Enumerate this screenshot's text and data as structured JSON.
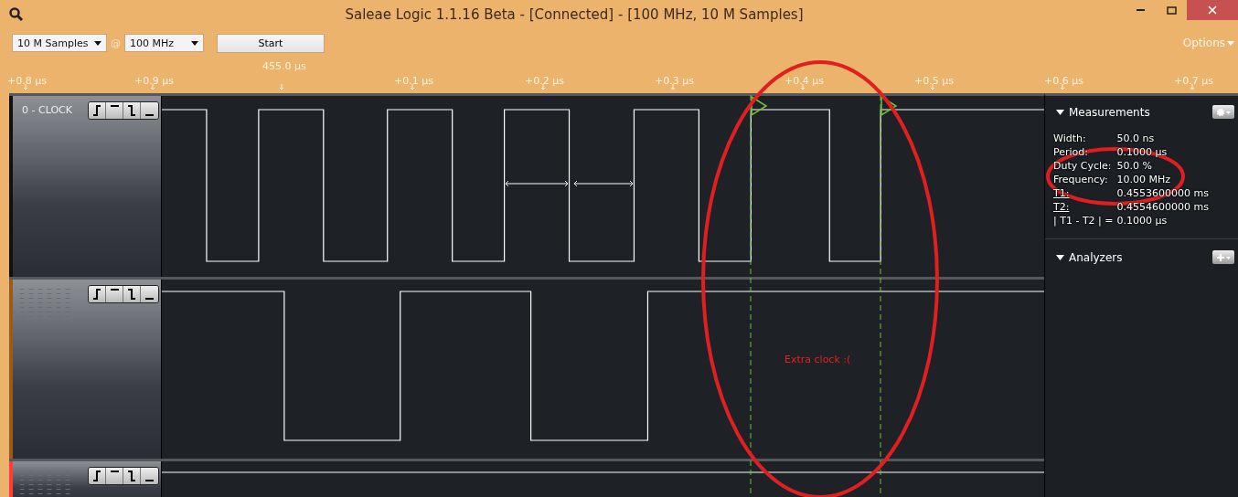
{
  "window": {
    "title": "Saleae Logic 1.1.16 Beta - [Connected] - [100 MHz, 10 M Samples]"
  },
  "toolbar": {
    "samples": "10 M Samples",
    "at": "@",
    "rate": "100 MHz",
    "start": "Start",
    "options": "Options"
  },
  "ruler": {
    "cursor": "455.0 µs",
    "labels": [
      "+0.8 µs",
      "+0.9 µs",
      "+0.1 µs",
      "+0.2 µs",
      "+0.3 µs",
      "+0.4 µs",
      "+0.5 µs",
      "+0.6 µs",
      "+0.7 µs"
    ]
  },
  "channels": [
    {
      "name": "0 - CLOCK",
      "color": "#111111"
    },
    {
      "color": "#9a5a1c"
    },
    {
      "color": "#ff3b3b"
    }
  ],
  "measurements": {
    "title": "Measurements",
    "expanded": true,
    "rows": [
      {
        "label": "Width:",
        "value": "50.0 ns",
        "underlined": false
      },
      {
        "label": "Period:",
        "value": "0.1000 µs",
        "underlined": false
      },
      {
        "label": "Duty Cycle:",
        "value": "50.0 %",
        "underlined": false
      },
      {
        "label": "Frequency:",
        "value": "10.00 MHz",
        "underlined": false
      },
      {
        "label": "T1:",
        "value": "0.4553600000 ms",
        "underlined": true
      },
      {
        "label": "T2:",
        "value": "0.4554600000 ms",
        "underlined": true
      },
      {
        "label": "| T1 - T2 | =",
        "value": "0.1000 µs",
        "underlined": false
      }
    ]
  },
  "analyzers": {
    "title": "Analyzers",
    "expanded": true
  },
  "annotation": {
    "text": "Extra clock :("
  }
}
